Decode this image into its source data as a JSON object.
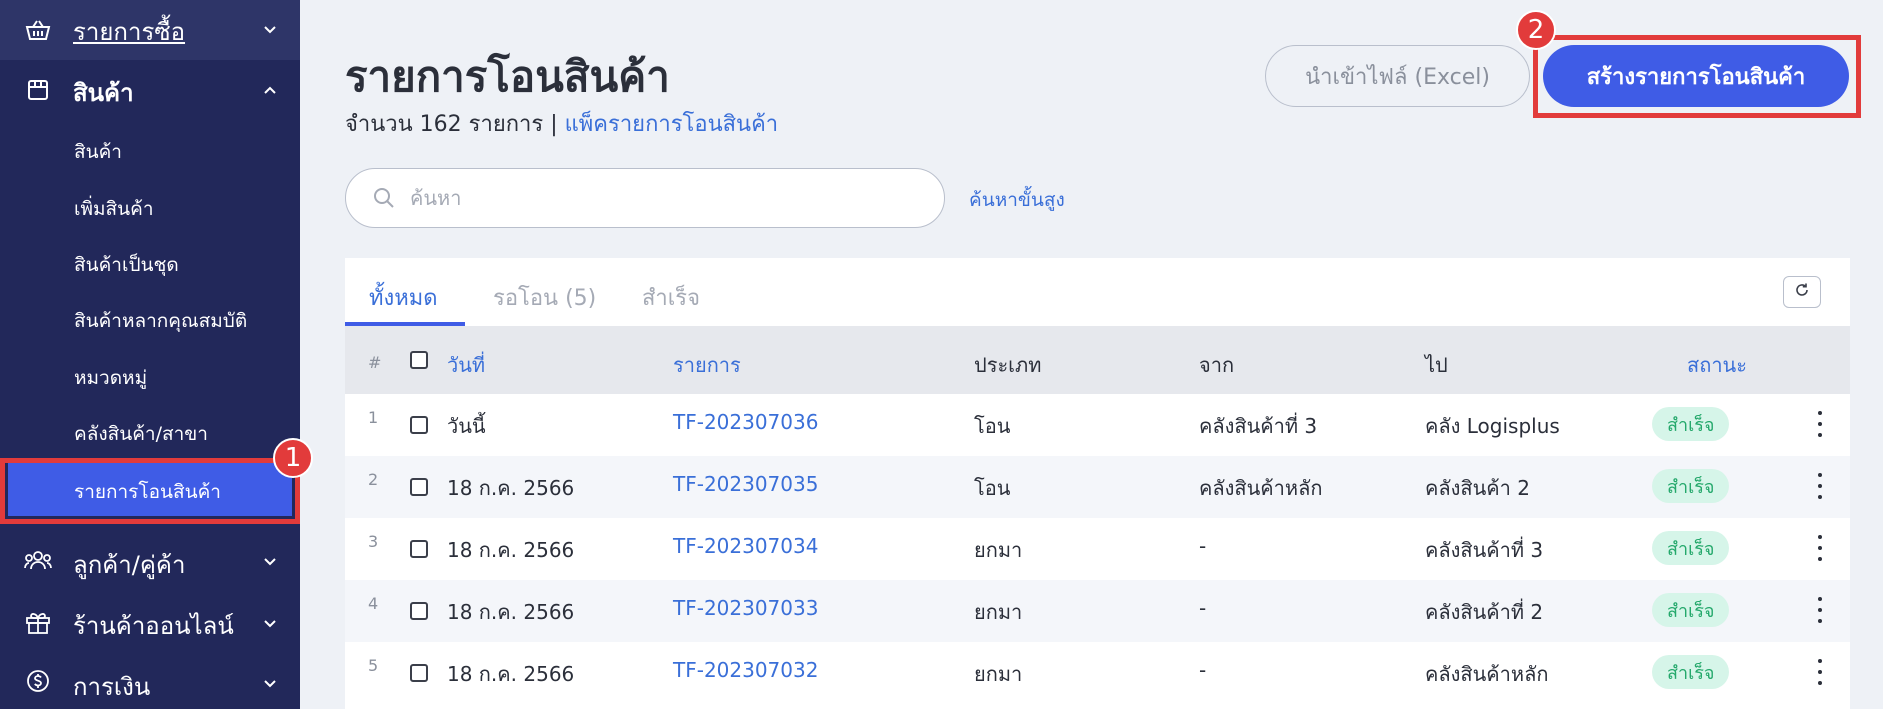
{
  "sidebar": {
    "top_item": {
      "label": "รายการซื้อ",
      "icon": "basket-icon"
    },
    "section": {
      "label": "สินค้า",
      "icon": "store-icon"
    },
    "sub_items": [
      {
        "label": "สินค้า"
      },
      {
        "label": "เพิ่มสินค้า"
      },
      {
        "label": "สินค้าเป็นชุด"
      },
      {
        "label": "สินค้าหลากคุณสมบัติ"
      },
      {
        "label": "หมวดหมู่"
      },
      {
        "label": "คลังสินค้า/สาขา"
      },
      {
        "label": "รายการโอนสินค้า"
      }
    ],
    "bottom_items": [
      {
        "label": "ลูกค้า/คู่ค้า",
        "icon": "users-icon"
      },
      {
        "label": "ร้านค้าออนไลน์",
        "icon": "gift-icon"
      },
      {
        "label": "การเงิน",
        "icon": "dollar-icon"
      }
    ]
  },
  "annotations": {
    "step1": "1",
    "step2": "2"
  },
  "header": {
    "title": "รายการโอนสินค้า",
    "count_text": "จำนวน 162 รายการ | ",
    "pack_link": "แพ็ครายการโอนสินค้า",
    "import_button": "นำเข้าไฟล์ (Excel)",
    "create_button": "สร้างรายการโอนสินค้า"
  },
  "search": {
    "placeholder": "ค้นหา",
    "advanced": "ค้นหาขั้นสูง"
  },
  "tabs": [
    {
      "label": "ทั้งหมด"
    },
    {
      "label": "รอโอน (5)"
    },
    {
      "label": "สำเร็จ"
    }
  ],
  "table": {
    "columns": {
      "index": "#",
      "date": "วันที่",
      "item": "รายการ",
      "type": "ประเภท",
      "from": "จาก",
      "to": "ไป",
      "status": "สถานะ"
    },
    "rows": [
      {
        "index": "1",
        "date": "วันนี้",
        "item": "TF-202307036",
        "type": "โอน",
        "from": "คลังสินค้าที่ 3",
        "to": "คลัง Logisplus",
        "status": "สำเร็จ"
      },
      {
        "index": "2",
        "date": "18 ก.ค. 2566",
        "item": "TF-202307035",
        "type": "โอน",
        "from": "คลังสินค้าหลัก",
        "to": "คลังสินค้า 2",
        "status": "สำเร็จ"
      },
      {
        "index": "3",
        "date": "18 ก.ค. 2566",
        "item": "TF-202307034",
        "type": "ยกมา",
        "from": "-",
        "to": "คลังสินค้าที่ 3",
        "status": "สำเร็จ"
      },
      {
        "index": "4",
        "date": "18 ก.ค. 2566",
        "item": "TF-202307033",
        "type": "ยกมา",
        "from": "-",
        "to": "คลังสินค้าที่ 2",
        "status": "สำเร็จ"
      },
      {
        "index": "5",
        "date": "18 ก.ค. 2566",
        "item": "TF-202307032",
        "type": "ยกมา",
        "from": "-",
        "to": "คลังสินค้าหลัก",
        "status": "สำเร็จ"
      }
    ]
  },
  "colors": {
    "sidebar_bg": "#22285a",
    "accent": "#3f5ce6",
    "link": "#3a6fd8",
    "highlight": "#e23b3b",
    "status_bg": "#d6f5e9",
    "status_text": "#24a86b"
  }
}
